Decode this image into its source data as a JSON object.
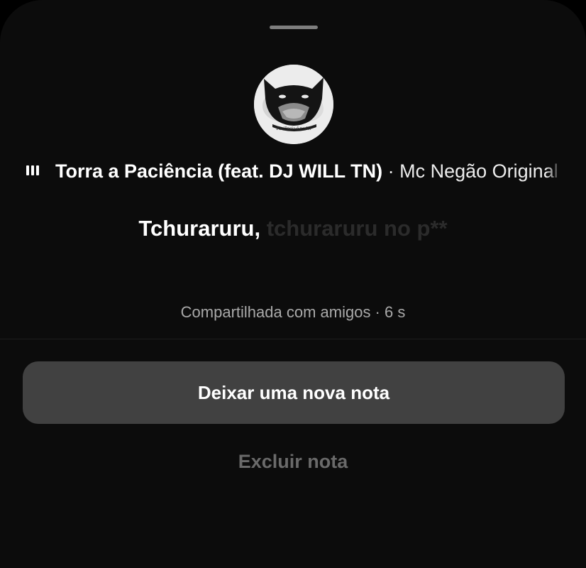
{
  "song": {
    "title": "Torra a Paciência (feat. DJ WILL TN)",
    "separator": " · ",
    "artist": "Mc Negão Original"
  },
  "avatar": {
    "caption": "Paciência é poder"
  },
  "lyrics": {
    "active": "Tchuraruru,",
    "upcoming": "tchuraruru no p**"
  },
  "meta": {
    "shared_text": "Compartilhada com amigos · 6 s"
  },
  "actions": {
    "new_note_label": "Deixar uma nova nota",
    "delete_label": "Excluir nota"
  },
  "icons": {
    "drag": "drag-handle-icon",
    "music": "music-bars-icon"
  },
  "colors": {
    "sheet_background": "#0c0c0c",
    "button_background": "#414141",
    "muted_text": "#a9a9a9",
    "delete_text": "#6a6a6a"
  }
}
